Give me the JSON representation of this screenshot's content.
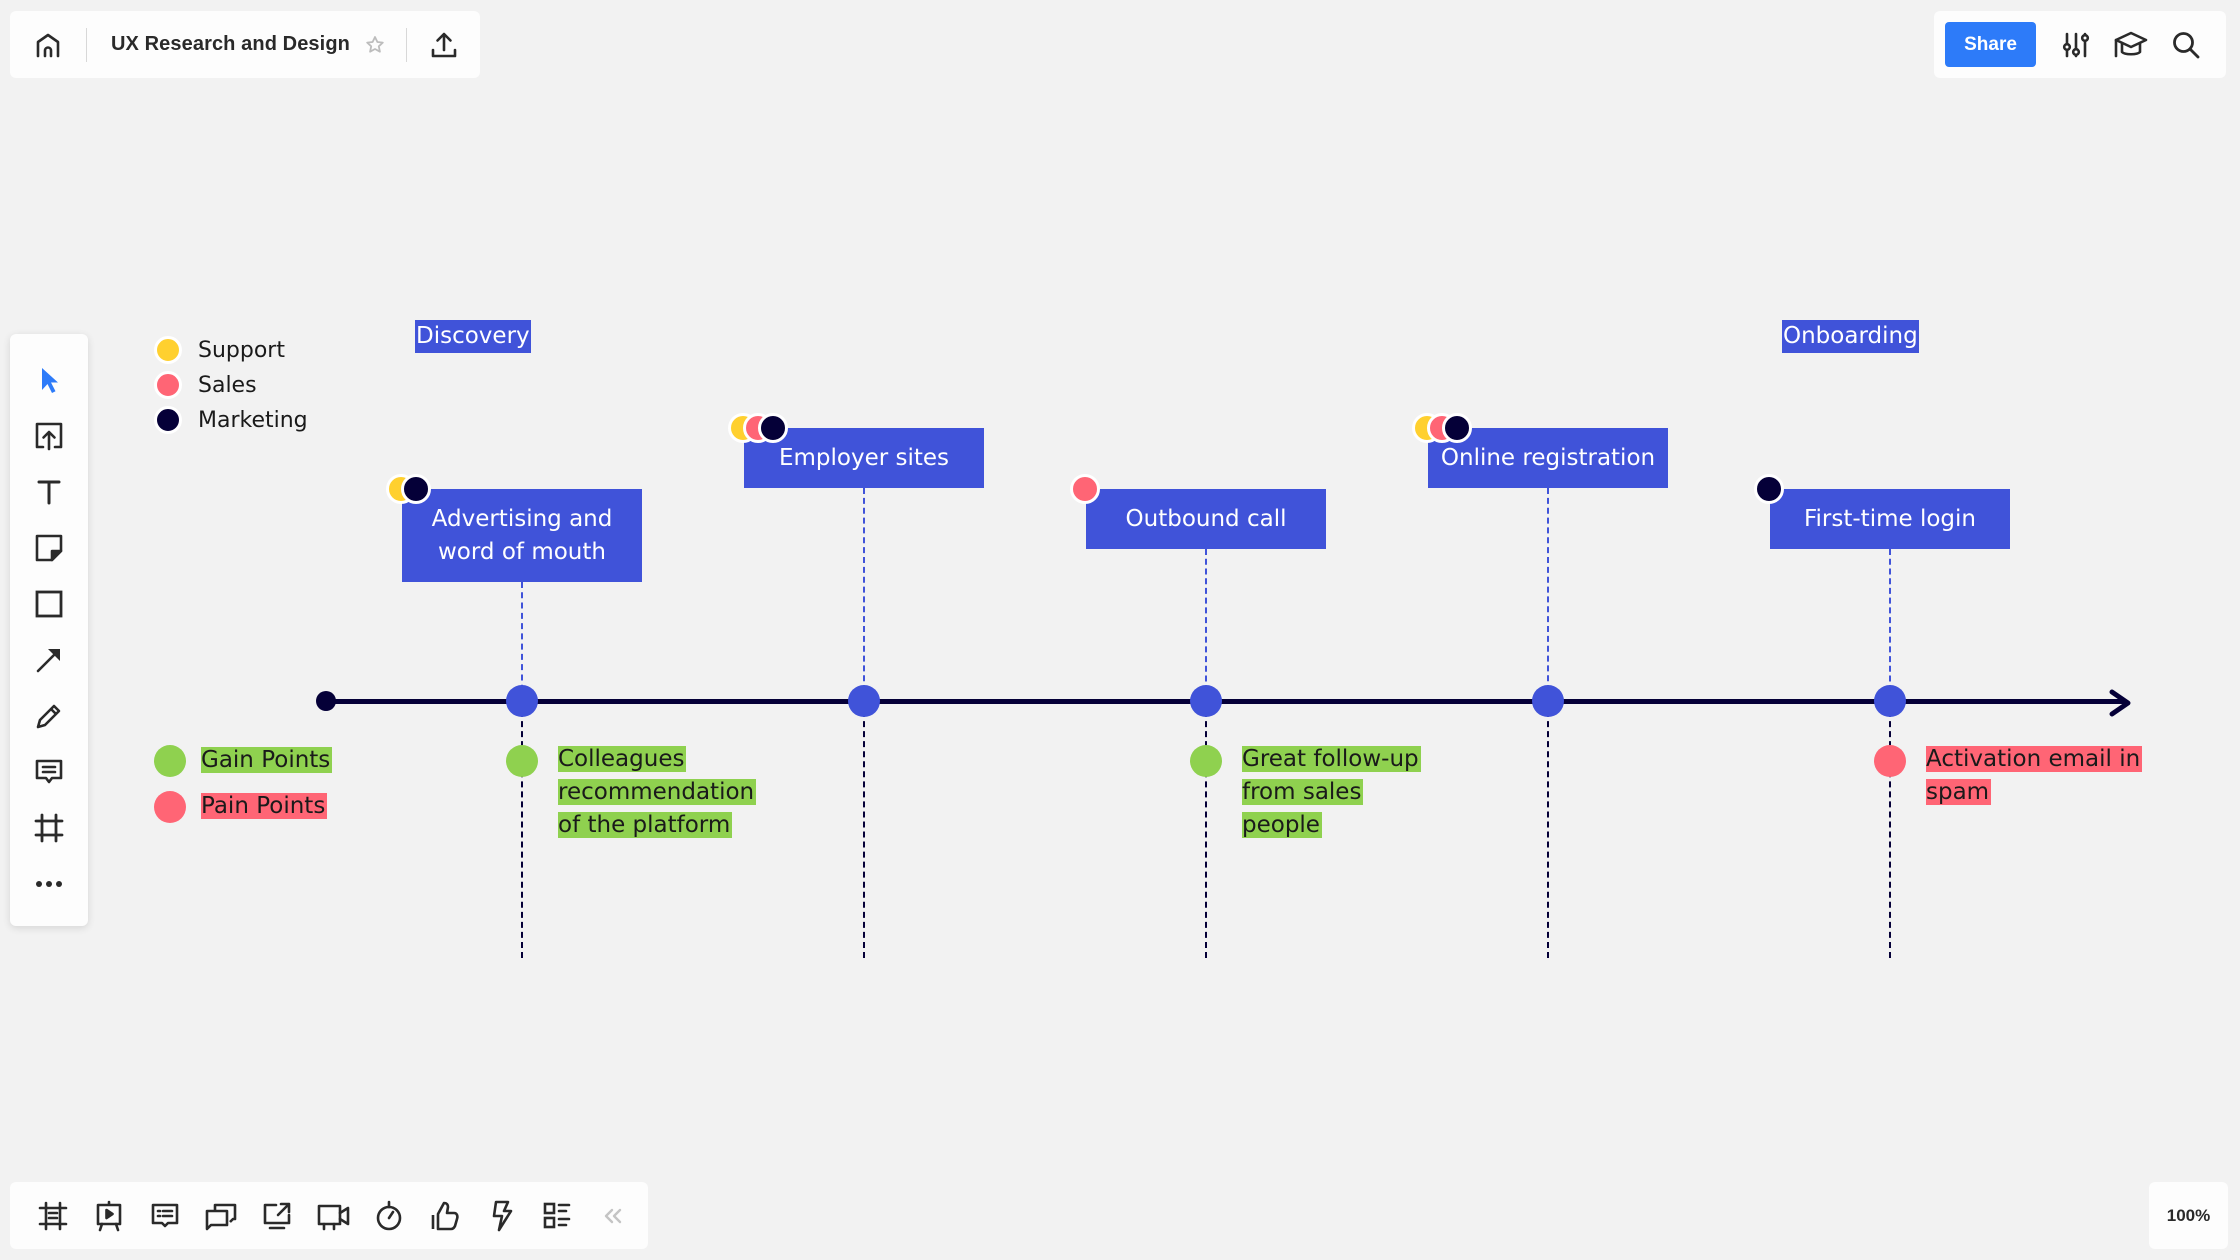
{
  "app": {
    "board_title": "UX Research and Design",
    "share_label": "Share",
    "zoom_level": "100%"
  },
  "topbar": {
    "icons": [
      "home-icon",
      "star-icon",
      "upload-icon"
    ]
  },
  "toprightbar": {
    "icons": [
      "settings-sliders-icon",
      "learning-cap-icon",
      "search-icon"
    ]
  },
  "left_toolbar": {
    "tools": [
      {
        "name": "select",
        "icon": "cursor-icon",
        "active": true
      },
      {
        "name": "upload",
        "icon": "upload-frame-icon"
      },
      {
        "name": "text",
        "icon": "text-icon"
      },
      {
        "name": "sticky-note",
        "icon": "sticky-note-icon"
      },
      {
        "name": "shape",
        "icon": "rectangle-icon"
      },
      {
        "name": "connection-line",
        "icon": "arrow-icon"
      },
      {
        "name": "pen",
        "icon": "pen-icon"
      },
      {
        "name": "comment",
        "icon": "comment-icon"
      },
      {
        "name": "frame",
        "icon": "frame-icon"
      },
      {
        "name": "more",
        "icon": "more-icon"
      }
    ]
  },
  "bottom_toolbar": {
    "tools": [
      {
        "name": "frames",
        "icon": "frames-icon"
      },
      {
        "name": "presentation",
        "icon": "presentation-icon"
      },
      {
        "name": "comments",
        "icon": "comments-icon"
      },
      {
        "name": "chat",
        "icon": "chat-icon"
      },
      {
        "name": "screen-share",
        "icon": "screen-share-icon"
      },
      {
        "name": "video-call",
        "icon": "video-icon"
      },
      {
        "name": "timer",
        "icon": "timer-icon"
      },
      {
        "name": "voting",
        "icon": "thumbs-up-icon"
      },
      {
        "name": "activity",
        "icon": "lightning-icon"
      },
      {
        "name": "card-list",
        "icon": "card-list-icon"
      },
      {
        "name": "collapse",
        "icon": "double-chevron-left-icon"
      }
    ]
  },
  "colors": {
    "support": "#ffd02f",
    "sales": "#ff6575",
    "marketing": "#050038",
    "card": "#4053d9",
    "gain": "#8fd14f",
    "pain": "#ff6575",
    "accent": "#2d7bf9"
  },
  "legend": {
    "teams": [
      {
        "label": "Support",
        "color": "#ffd02f"
      },
      {
        "label": "Sales",
        "color": "#ff6575"
      },
      {
        "label": "Marketing",
        "color": "#050038"
      }
    ],
    "points": [
      {
        "label": "Gain Points",
        "color": "#8fd14f"
      },
      {
        "label": "Pain Points",
        "color": "#ff6575"
      }
    ]
  },
  "phases": [
    {
      "label": "Discovery"
    },
    {
      "label": "Onboarding"
    }
  ],
  "journey": {
    "steps": [
      {
        "title": "Advertising and word of mouth",
        "teams": [
          "support",
          "marketing"
        ],
        "point": {
          "type": "gain",
          "text": "Colleagues recommendation of the platform"
        }
      },
      {
        "title": "Employer sites",
        "teams": [
          "support",
          "sales",
          "marketing"
        ],
        "point": null
      },
      {
        "title": "Outbound call",
        "teams": [
          "sales"
        ],
        "point": {
          "type": "gain",
          "text": "Great follow-up from sales people"
        }
      },
      {
        "title": "Online registration",
        "teams": [
          "support",
          "sales",
          "marketing"
        ],
        "point": null
      },
      {
        "title": "First-time login",
        "teams": [
          "marketing"
        ],
        "point": {
          "type": "pain",
          "text": "Activation email in spam"
        }
      }
    ]
  }
}
